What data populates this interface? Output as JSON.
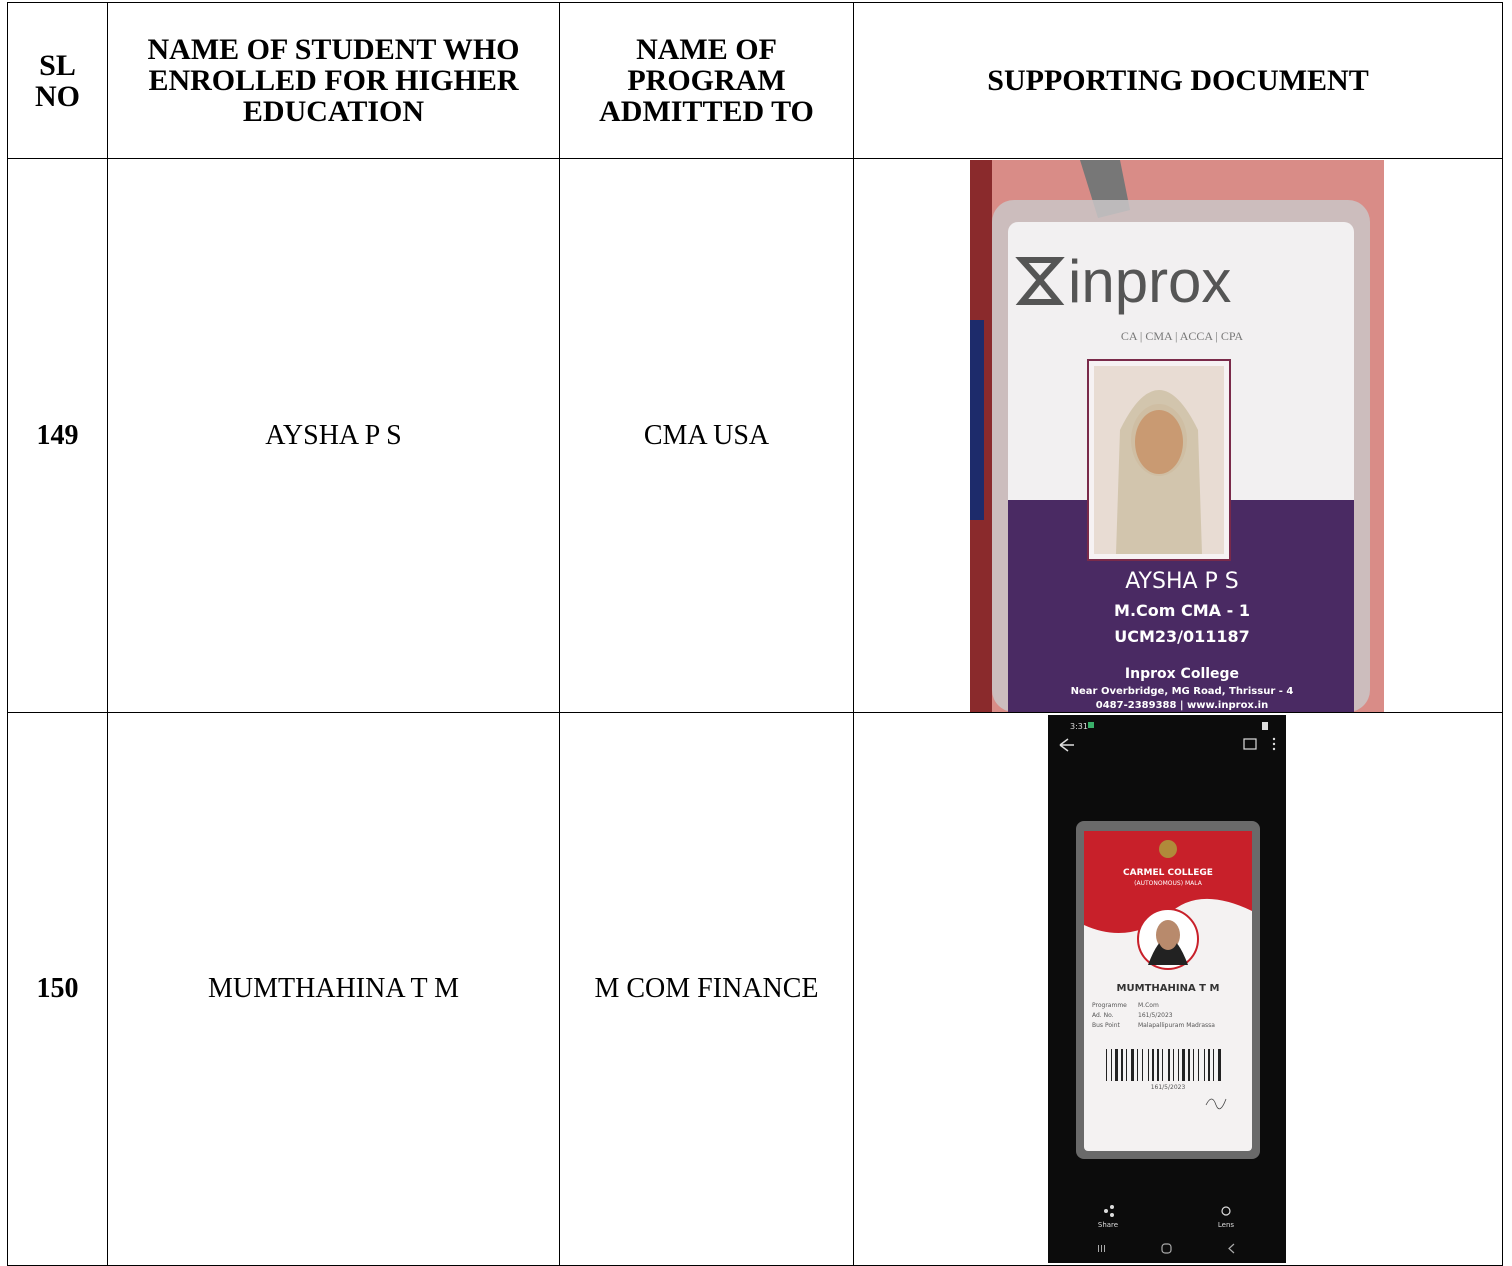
{
  "table": {
    "headers": [
      "SL NO",
      "NAME OF STUDENT WHO ENROLLED FOR HIGHER EDUCATION",
      "NAME OF PROGRAM ADMITTED TO",
      "SUPPORTING DOCUMENT"
    ],
    "rows": [
      {
        "sl_no": "149",
        "student": "AYSHA P S",
        "program": "CMA USA",
        "document": {
          "brand": "inprox",
          "tagline": "CA | CMA | ACCA | CPA",
          "name": "AYSHA P S",
          "course": "M.Com CMA - 1",
          "id": "UCM23/011187",
          "college": "Inprox College",
          "address": "Near Overbridge, MG Road, Thrissur - 4",
          "contact": "0487-2389388 | www.inprox.in"
        }
      },
      {
        "sl_no": "150",
        "student": "MUMTHAHINA T M",
        "program": "M COM FINANCE",
        "document": {
          "status_time": "3:31",
          "college": "CARMEL COLLEGE",
          "college_sub": "(AUTONOMOUS) MALA",
          "name": "MUMTHAHINA T M",
          "fields": [
            {
              "label": "Programme",
              "value": "M.Com"
            },
            {
              "label": "Ad. No.",
              "value": "161/5/2023"
            },
            {
              "label": "Bus Point",
              "value": "Malapallipuram Madrassa"
            }
          ],
          "barcode_text": "161/5/2023",
          "share_label": "Share",
          "lens_label": "Lens"
        }
      }
    ]
  },
  "colors": {
    "inprox_purple": "#4a2a63",
    "carmel_red": "#c8202a",
    "wall_pink": "#d98c87"
  }
}
